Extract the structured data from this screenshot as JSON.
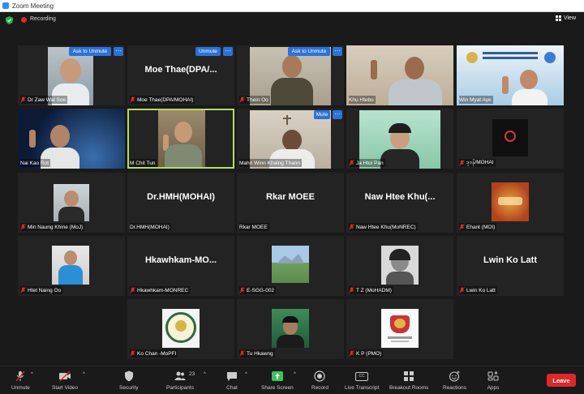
{
  "window": {
    "title": "Zoom Meeting"
  },
  "topbar": {
    "recording": "Recording",
    "view": "View"
  },
  "tiles": [
    {
      "name": "Dr Zaw Wai Soe",
      "overlay": "Ask to Unmute"
    },
    {
      "name": "Moe Thae(DPA/MOHAI)",
      "big": "Moe Thae(DPA/...",
      "overlay": "Unmute"
    },
    {
      "name": "Thein Oo",
      "overlay": "Ask to Unmute"
    },
    {
      "name": "Khu Htebu"
    },
    {
      "name": "Win Myat Aye"
    },
    {
      "name": "Nai Kao Rot"
    },
    {
      "name": "M Chit Tun"
    },
    {
      "name": "Mahn Winn Khaing Thann",
      "overlay": "Mute"
    },
    {
      "name": "Ja Htoi Pan"
    },
    {
      "name": "ဒုဝန်/MOHAI"
    },
    {
      "name": "Min Naung Khine (MoJ)"
    },
    {
      "name": "Dr.HMH(MOHAI)",
      "big": "Dr.HMH(MOHAI)"
    },
    {
      "name": "Rkar MOEE",
      "big": "Rkar MOEE"
    },
    {
      "name": "Naw Htee Khu(MoNREC)",
      "big": "Naw Htee Khu(..."
    },
    {
      "name": "Ehant (MOI)"
    },
    {
      "name": "Htet Naing Oo"
    },
    {
      "name": "Hkawhkam-MONREC",
      "big": "Hkawhkam-MO..."
    },
    {
      "name": "E-SGG-002"
    },
    {
      "name": "T Z (MoHADM)"
    },
    {
      "name": "Lwin Ko Latt",
      "big": "Lwin Ko Latt"
    },
    {
      "name": "Ko Chan -MoPFI"
    },
    {
      "name": "Tu Hkawng"
    },
    {
      "name": "K P (PMO)"
    }
  ],
  "toolbar": {
    "unmute": "Unmute",
    "start_video": "Start Video",
    "security": "Security",
    "participants": "Participants",
    "participants_count": "23",
    "chat": "Chat",
    "share_screen": "Share Screen",
    "record": "Record",
    "live_transcript": "Live Transcript",
    "breakout_rooms": "Breakout Rooms",
    "reactions": "Reactions",
    "apps": "Apps",
    "leave": "Leave",
    "cc": "CC"
  },
  "colors": {
    "accent": "#2d72d9",
    "leave": "#e02828",
    "share": "#3cc25f",
    "active_border": "#b6dc5e"
  }
}
